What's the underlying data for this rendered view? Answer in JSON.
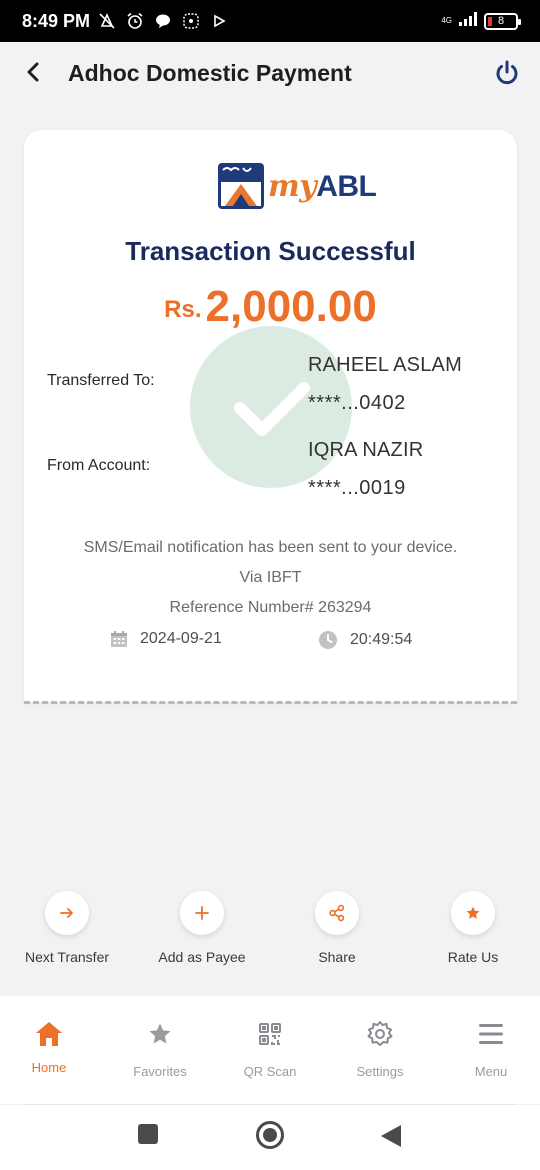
{
  "status_bar": {
    "time": "8:49 PM",
    "network": "4G",
    "battery": "8"
  },
  "header": {
    "title": "Adhoc Domestic Payment"
  },
  "receipt": {
    "logo_my": "my",
    "logo_abl": "ABL",
    "status": "Transaction Successful",
    "currency": "Rs.",
    "amount": "2,000.00",
    "transferred_to_label": "Transferred To:",
    "transferred_to_name": "RAHEEL ASLAM",
    "transferred_to_account": "****...0402",
    "from_account_label": "From Account:",
    "from_account_name": "IQRA NAZIR",
    "from_account_number": "****...0019",
    "notification": "SMS/Email notification has been sent to your device.",
    "via": "Via IBFT",
    "reference": "Reference Number# 263294",
    "date": "2024-09-21",
    "time": "20:49:54"
  },
  "actions": [
    {
      "label": "Next Transfer",
      "icon": "arrow-right-icon"
    },
    {
      "label": "Add as Payee",
      "icon": "plus-icon"
    },
    {
      "label": "Share",
      "icon": "share-icon"
    },
    {
      "label": "Rate Us",
      "icon": "star-icon"
    }
  ],
  "bottom_nav": [
    {
      "label": "Home",
      "icon": "home-icon",
      "active": true
    },
    {
      "label": "Favorites",
      "icon": "star-icon",
      "active": false
    },
    {
      "label": "QR Scan",
      "icon": "qr-code-icon",
      "active": false
    },
    {
      "label": "Settings",
      "icon": "gear-icon",
      "active": false
    },
    {
      "label": "Menu",
      "icon": "hamburger-menu-icon",
      "active": false
    }
  ],
  "colors": {
    "accent": "#ec6f2a",
    "brand_navy": "#1a2a5c",
    "icon_navy": "#1f3a78",
    "success_circle": "#dcebe2"
  }
}
